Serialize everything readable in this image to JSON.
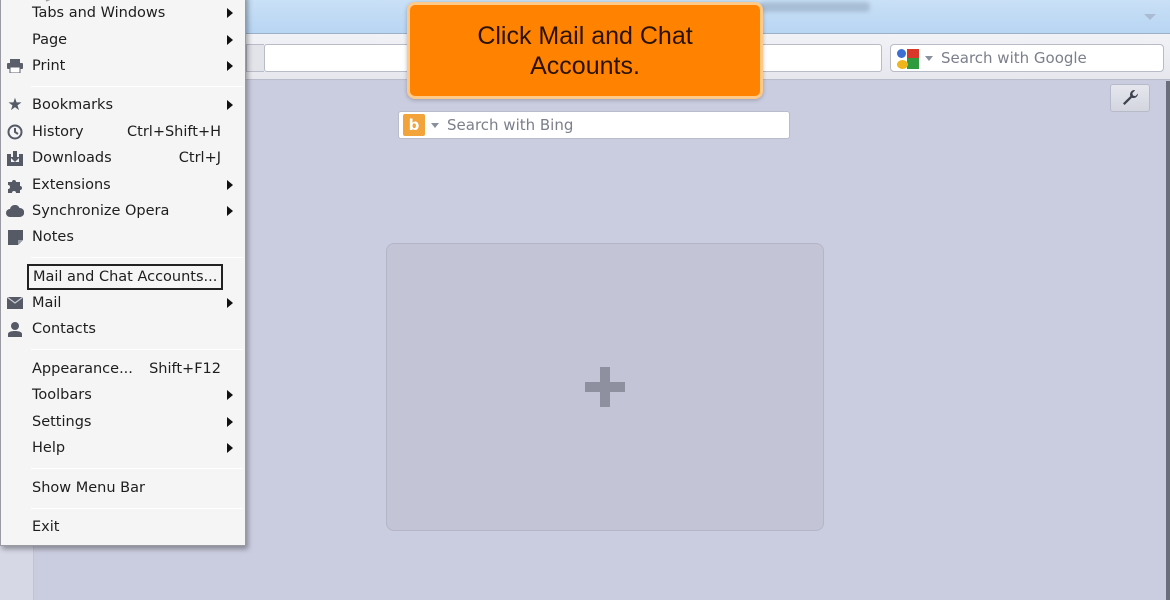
{
  "browser": {
    "address_value": "",
    "google_search": {
      "placeholder": "Search with Google",
      "engine_icon": "google-icon"
    },
    "bing_search": {
      "placeholder": "Search with Bing",
      "engine_icon": "bing-icon",
      "logo_glyph": "b"
    },
    "tools_icon": "wrench-icon",
    "speed_dial": {
      "add_icon": "plus-icon"
    }
  },
  "callout": {
    "text": "Click Mail and Chat Accounts.",
    "color": "#ff8200"
  },
  "menu": {
    "items": [
      {
        "label": "Tabs and Windows",
        "shortcut": "",
        "submenu": true,
        "icon": ""
      },
      {
        "label": "Page",
        "shortcut": "",
        "submenu": true,
        "icon": ""
      },
      {
        "label": "Print",
        "shortcut": "",
        "submenu": true,
        "icon": "printer-icon"
      },
      {
        "label": "Bookmarks",
        "shortcut": "",
        "submenu": true,
        "icon": "star-icon"
      },
      {
        "label": "History",
        "shortcut": "Ctrl+Shift+H",
        "submenu": false,
        "icon": "clock-icon"
      },
      {
        "label": "Downloads",
        "shortcut": "Ctrl+J",
        "submenu": false,
        "icon": "download-icon"
      },
      {
        "label": "Extensions",
        "shortcut": "",
        "submenu": true,
        "icon": "puzzle-icon"
      },
      {
        "label": "Synchronize Opera",
        "shortcut": "",
        "submenu": true,
        "icon": "cloud-icon"
      },
      {
        "label": "Notes",
        "shortcut": "",
        "submenu": false,
        "icon": "note-icon"
      },
      {
        "label": "Mail and Chat Accounts...",
        "shortcut": "",
        "submenu": false,
        "icon": "",
        "focused": true
      },
      {
        "label": "Mail",
        "shortcut": "",
        "submenu": true,
        "icon": "envelope-icon"
      },
      {
        "label": "Contacts",
        "shortcut": "",
        "submenu": false,
        "icon": "person-icon"
      },
      {
        "label": "Appearance...",
        "shortcut": "Shift+F12",
        "submenu": false,
        "icon": ""
      },
      {
        "label": "Toolbars",
        "shortcut": "",
        "submenu": true,
        "icon": ""
      },
      {
        "label": "Settings",
        "shortcut": "",
        "submenu": true,
        "icon": ""
      },
      {
        "label": "Help",
        "shortcut": "",
        "submenu": true,
        "icon": ""
      },
      {
        "label": "Show Menu Bar",
        "shortcut": "",
        "submenu": false,
        "icon": ""
      },
      {
        "label": "Exit",
        "shortcut": "",
        "submenu": false,
        "icon": ""
      }
    ]
  }
}
